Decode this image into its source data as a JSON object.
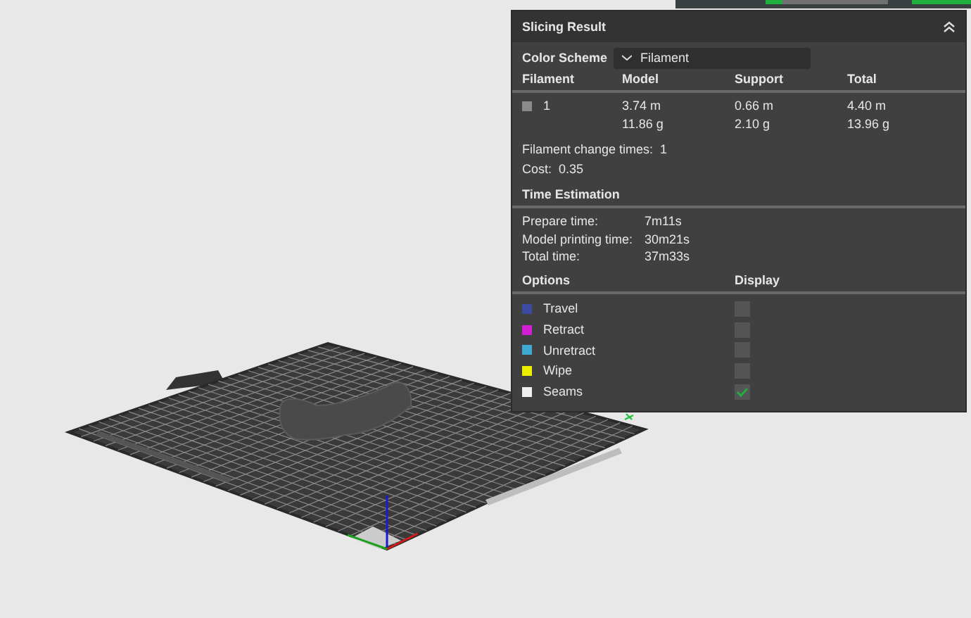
{
  "panel": {
    "title": "Slicing Result",
    "expanded": true,
    "color_scheme": {
      "label": "Color Scheme",
      "value": "Filament"
    },
    "filament_table": {
      "columns": [
        "Filament",
        "Model",
        "Support",
        "Total"
      ],
      "rows": [
        {
          "color": "#8a8a8a",
          "filament": "1",
          "model": [
            "3.74 m",
            "11.86 g"
          ],
          "support": [
            "0.66 m",
            "2.10 g"
          ],
          "total": [
            "4.40 m",
            "13.96 g"
          ]
        }
      ]
    },
    "summary": [
      {
        "label": "Filament change times:",
        "value": "1"
      },
      {
        "label": "Cost:",
        "value": "0.35"
      }
    ],
    "time_estimation": {
      "title": "Time Estimation",
      "rows": [
        {
          "label": "Prepare time:",
          "value": "7m11s"
        },
        {
          "label": "Model printing time:",
          "value": "30m21s"
        },
        {
          "label": "Total time:",
          "value": "37m33s"
        }
      ]
    },
    "options": {
      "columns": [
        "Options",
        "Display"
      ],
      "items": [
        {
          "label": "Travel",
          "color": "#3c4aa0",
          "checked": false
        },
        {
          "label": "Retract",
          "color": "#d21fd2",
          "checked": false
        },
        {
          "label": "Unretract",
          "color": "#3fa9d2",
          "checked": false
        },
        {
          "label": "Wipe",
          "color": "#eeee00",
          "checked": false
        },
        {
          "label": "Seams",
          "color": "#f0f0f0",
          "checked": true
        }
      ]
    }
  }
}
